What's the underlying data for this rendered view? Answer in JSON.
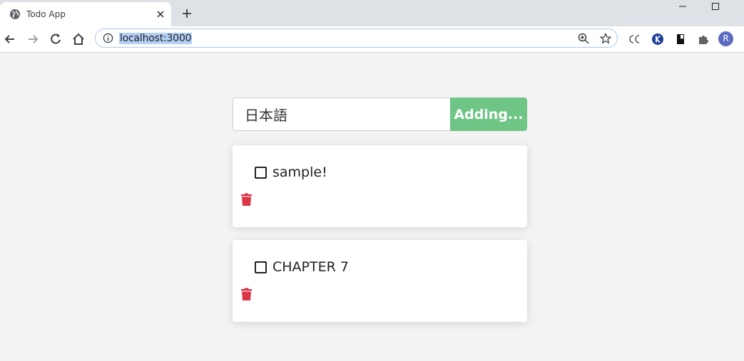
{
  "browser": {
    "tab_title": "Todo App",
    "url": "localhost:3000",
    "profile_initial": "R"
  },
  "app": {
    "input_value": "日本語",
    "add_button_label": "Adding...",
    "todos": [
      {
        "label": "sample!",
        "checked": false
      },
      {
        "label": "CHAPTER 7",
        "checked": false
      }
    ]
  },
  "colors": {
    "add_button": "#6fc586",
    "delete_icon": "#dc3545",
    "background": "#f3f3f3"
  }
}
